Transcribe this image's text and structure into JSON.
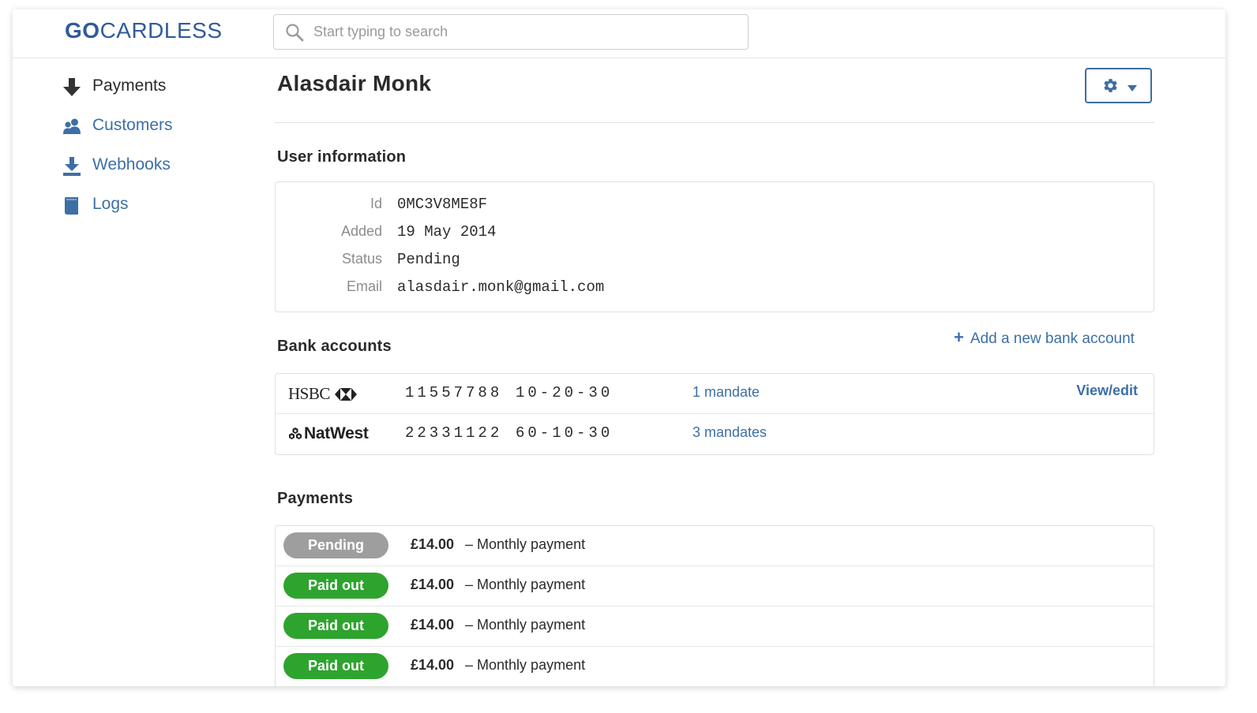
{
  "logo": {
    "part1": "GO",
    "part2": "CARDLESS"
  },
  "search": {
    "placeholder": "Start typing to search",
    "value": ""
  },
  "sidebar": {
    "items": [
      {
        "label": "Payments",
        "icon": "arrow-down-icon",
        "active": true
      },
      {
        "label": "Customers",
        "icon": "users-icon",
        "active": false
      },
      {
        "label": "Webhooks",
        "icon": "download-icon",
        "active": false
      },
      {
        "label": "Logs",
        "icon": "book-icon",
        "active": false
      }
    ]
  },
  "page": {
    "title": "Alasdair Monk"
  },
  "user_info": {
    "heading": "User information",
    "rows": [
      {
        "label": "Id",
        "value": "0MC3V8ME8F"
      },
      {
        "label": "Added",
        "value": "19 May 2014"
      },
      {
        "label": "Status",
        "value": "Pending"
      },
      {
        "label": "Email",
        "value": "alasdair.monk@gmail.com"
      }
    ]
  },
  "bank_accounts": {
    "heading": "Bank accounts",
    "add_label": "Add a new bank account",
    "view_edit_label": "View/edit",
    "accounts": [
      {
        "bank": "HSBC",
        "account_number": "11557788",
        "sort_code": "10-20-30",
        "mandates": "1 mandate"
      },
      {
        "bank": "NatWest",
        "account_number": "22331122",
        "sort_code": "60-10-30",
        "mandates": "3 mandates"
      }
    ]
  },
  "payments": {
    "heading": "Payments",
    "separator": "–",
    "items": [
      {
        "status": "Pending",
        "amount": "£14.00",
        "description": "Monthly payment"
      },
      {
        "status": "Paid out",
        "amount": "£14.00",
        "description": "Monthly payment"
      },
      {
        "status": "Paid out",
        "amount": "£14.00",
        "description": "Monthly payment"
      },
      {
        "status": "Paid out",
        "amount": "£14.00",
        "description": "Monthly payment"
      }
    ]
  },
  "colors": {
    "accent": "#3d6fa6",
    "logo": "#315a9c",
    "pending": "#9e9e9e",
    "paid_out": "#2da42d"
  }
}
